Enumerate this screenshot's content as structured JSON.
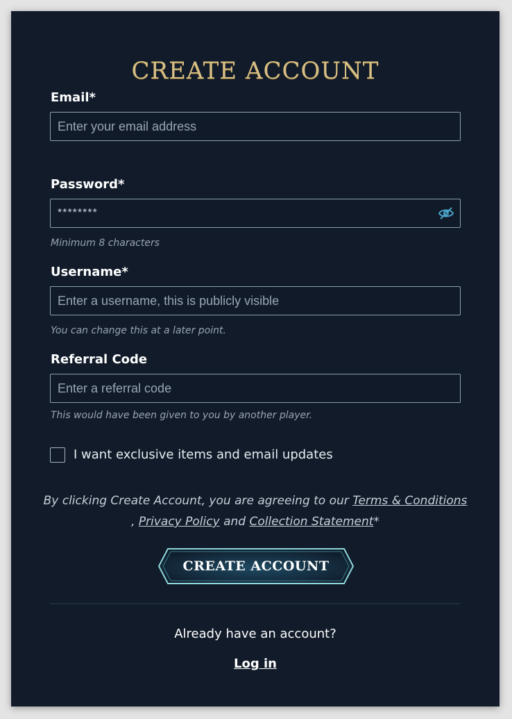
{
  "form": {
    "title": "CREATE ACCOUNT",
    "email": {
      "label": "Email*",
      "placeholder": "Enter your email address",
      "value": ""
    },
    "password": {
      "label": "Password*",
      "value": "********",
      "hint": "Minimum 8 characters",
      "toggle_icon": "eye-slash-icon"
    },
    "username": {
      "label": "Username*",
      "placeholder": "Enter a username, this is publicly visible",
      "hint": "You can change this at a later point."
    },
    "referral": {
      "label": "Referral Code",
      "placeholder": "Enter a referral code",
      "hint": "This would have been given to you by another player."
    },
    "updates_checkbox": {
      "label": "I want exclusive items and email updates",
      "checked": false
    },
    "terms": {
      "prefix": "By clicking Create Account, you are agreeing to our",
      "terms_link": "Terms & Conditions",
      "comma": ",",
      "privacy_link": "Privacy Policy",
      "and": "and",
      "collection_link": "Collection Statement",
      "suffix": "*"
    },
    "submit_label": "CREATE ACCOUNT",
    "have_account_text": "Already have an account?",
    "login_link": "Log in"
  },
  "colors": {
    "panel_bg": "#111b2a",
    "title_gold": "#d8bf84",
    "button_border": "#7fd3d9",
    "page_bg": "#e4e4e4"
  }
}
